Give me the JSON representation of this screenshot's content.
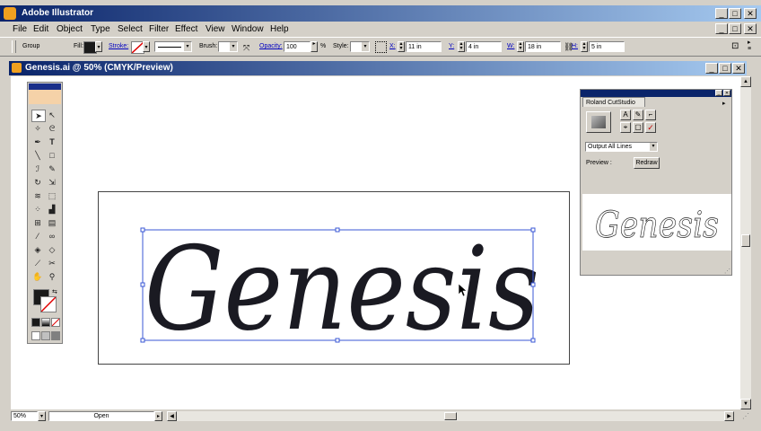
{
  "app": {
    "title": "Adobe Illustrator"
  },
  "menu": [
    "File",
    "Edit",
    "Object",
    "Type",
    "Select",
    "Filter",
    "Effect",
    "View",
    "Window",
    "Help"
  ],
  "control": {
    "selection": "Group",
    "fill_label": "Fill:",
    "stroke_label": "Stroke:",
    "brush_label": "Brush:",
    "opacity_label": "Opacity:",
    "opacity_value": "100",
    "opacity_unit": "%",
    "style_label": "Style:",
    "x_label": "X:",
    "x_value": "11 in",
    "y_label": "Y:",
    "y_value": "4 in",
    "w_label": "W:",
    "w_value": "18 in",
    "h_label": "H:",
    "h_value": "5 in"
  },
  "document": {
    "title": "Genesis.ai @ 50% (CMYK/Preview)",
    "artwork_text": "Genesis"
  },
  "status": {
    "zoom": "50%",
    "info": "Open"
  },
  "plugin": {
    "title": "Roland CutStudio",
    "output_option": "Output All Lines",
    "preview_label": "Preview :",
    "redraw_label": "Redraw",
    "preview_text": "Genesis"
  },
  "colors": {
    "titlebar": "#0a246a",
    "selection": "#3a57d6",
    "artwork": "#1a1a22"
  }
}
